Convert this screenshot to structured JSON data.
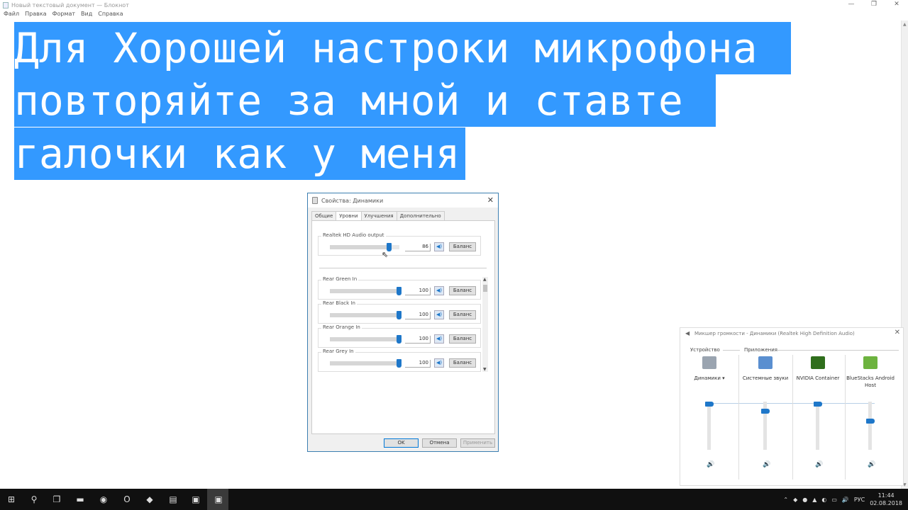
{
  "notepad": {
    "title": "Новый текстовый документ — Блокнот",
    "window_controls": [
      "—",
      "❐",
      "✕"
    ],
    "menu": [
      "Файл",
      "Правка",
      "Формат",
      "Вид",
      "Справка"
    ],
    "text_lines": [
      "Для Хорошей настроки микрофона ",
      "повторяйте за мной и ставте ",
      "галочки как у меня"
    ]
  },
  "dialog": {
    "title": "Свойства: Динамики",
    "close": "✕",
    "tabs": [
      "Общие",
      "Уровни",
      "Улучшения",
      "Дополнительно"
    ],
    "active_tab": "Уровни",
    "main": {
      "label": "Realtek HD Audio output",
      "value": "86",
      "level": 0.86,
      "balance": "Баланс"
    },
    "inputs": [
      {
        "label": "Rear Green In",
        "value": "100",
        "level": 1.0,
        "balance": "Баланс"
      },
      {
        "label": "Rear Black In",
        "value": "100",
        "level": 1.0,
        "balance": "Баланс"
      },
      {
        "label": "Rear Orange In",
        "value": "100",
        "level": 1.0,
        "balance": "Баланс"
      },
      {
        "label": "Rear Grey In",
        "value": "100",
        "level": 1.0,
        "balance": "Баланс"
      }
    ],
    "buttons": {
      "ok": "OK",
      "cancel": "Отмена",
      "apply": "Применить"
    }
  },
  "mixer": {
    "title": "Микшер громкости - Динамики (Realtek High Definition Audio)",
    "close": "✕",
    "device_header": "Устройство",
    "apps_header": "Приложения",
    "device": {
      "label": "Динамики",
      "dropdown": "▾",
      "level": 1.0,
      "icon": "speaker-device-icon",
      "color": "#9aa4b0"
    },
    "apps": [
      {
        "label": "Системные звуки",
        "level": 0.85,
        "icon": "system-sounds-icon",
        "color": "#5a8fd0"
      },
      {
        "label": "NVIDIA Container",
        "level": 1.0,
        "icon": "nvidia-icon",
        "color": "#2f6e1c"
      },
      {
        "label": "BlueStacks Android Host",
        "level": 0.65,
        "icon": "bluestacks-icon",
        "color": "#6db33f"
      }
    ]
  },
  "taskbar": {
    "icons": [
      {
        "name": "start-icon",
        "glyph": "⊞"
      },
      {
        "name": "search-icon",
        "glyph": "⚲"
      },
      {
        "name": "task-view-icon",
        "glyph": "❐"
      },
      {
        "name": "explorer-icon",
        "glyph": "▬"
      },
      {
        "name": "chrome-icon",
        "glyph": "◉"
      },
      {
        "name": "opera-icon",
        "glyph": "O"
      },
      {
        "name": "bluestacks-icon",
        "glyph": "◆"
      },
      {
        "name": "notepad-icon",
        "glyph": "▤"
      },
      {
        "name": "speaker-props-icon",
        "glyph": "▣"
      },
      {
        "name": "mixer-icon",
        "glyph": "▣"
      }
    ],
    "tray_icons": [
      "⌃",
      "◆",
      "●",
      "▲",
      "◐",
      "▭",
      "🔊",
      "РУС"
    ],
    "language": "РУС",
    "time": "11:44",
    "date": "02.08.2018"
  }
}
